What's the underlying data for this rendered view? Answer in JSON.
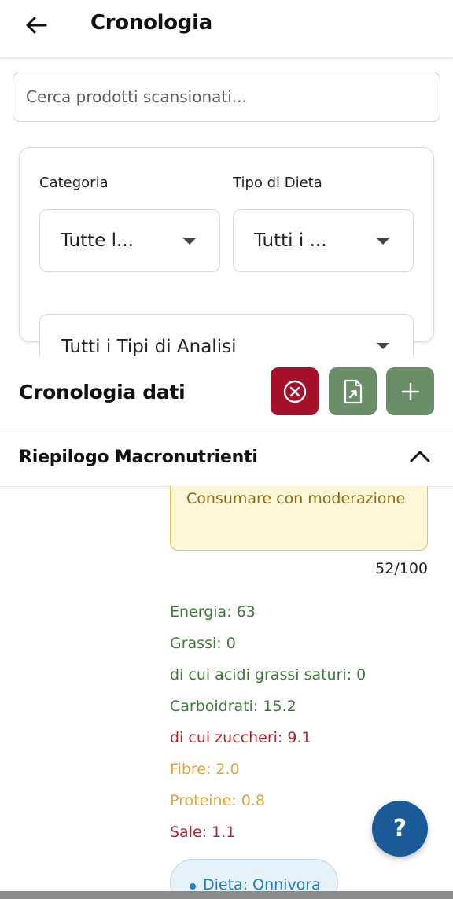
{
  "appbar": {
    "title": "Cronologia"
  },
  "search": {
    "placeholder": "Cerca prodotti scansionati..."
  },
  "filters": {
    "category_label": "Categoria",
    "category_value": "Tutte l...",
    "diet_label": "Tipo di Dieta",
    "diet_value": "Tutti i ...",
    "analysis_value": "Tutti i Tipi di Analisi"
  },
  "data_section": {
    "title": "Cronologia dati"
  },
  "summary": {
    "title": "Riepilogo Macronutrienti"
  },
  "card": {
    "warning": "Consumare con moderazione",
    "score": "52/100",
    "nutrients": [
      {
        "label": "Energia: 63",
        "color": "#3f7a3a"
      },
      {
        "label": "Grassi: 0",
        "color": "#3f7a3a"
      },
      {
        "label": "di cui acidi grassi saturi: 0",
        "color": "#3f7a3a"
      },
      {
        "label": "Carboidrati: 15.2",
        "color": "#3f7a3a"
      },
      {
        "label": "di cui zuccheri: 9.1",
        "color": "#b3262b"
      },
      {
        "label": "Fibre: 2.0",
        "color": "#e3a33b"
      },
      {
        "label": "Proteine: 0.8",
        "color": "#e3a33b"
      },
      {
        "label": "Sale: 1.1",
        "color": "#b3262b"
      }
    ],
    "diet_chip": "Dieta: Onnivora"
  },
  "fab": {
    "label": "?"
  },
  "colors": {
    "danger": "#a5112a",
    "primary_green": "#6a8e67",
    "fab_blue": "#1a5b9a"
  }
}
